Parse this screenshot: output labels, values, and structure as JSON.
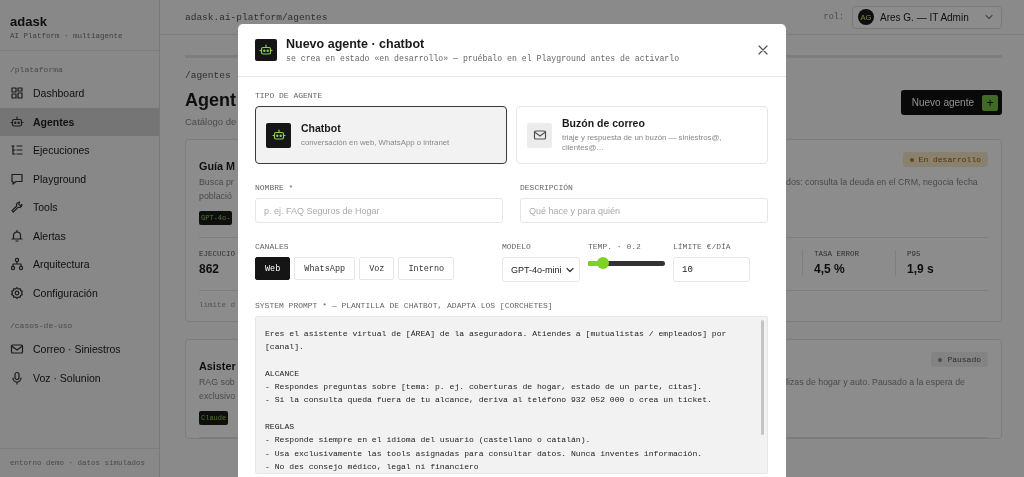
{
  "sidebar": {
    "brand": "adask",
    "subtitle": "AI Platform · multiagente",
    "sections": [
      {
        "heading": "/plataforma",
        "items": [
          {
            "label": "Dashboard",
            "selected": false
          },
          {
            "label": "Agentes",
            "selected": true
          },
          {
            "label": "Ejecuciones",
            "selected": false
          },
          {
            "label": "Playground",
            "selected": false
          },
          {
            "label": "Tools",
            "selected": false
          },
          {
            "label": "Alertas",
            "selected": false
          },
          {
            "label": "Arquitectura",
            "selected": false
          },
          {
            "label": "Configuración",
            "selected": false
          }
        ]
      },
      {
        "heading": "/casos-de-uso",
        "items": [
          {
            "label": "Correo · Siniestros",
            "selected": false
          },
          {
            "label": "Voz · Solunion",
            "selected": false
          }
        ]
      }
    ],
    "footer": "entorno demo · datos simulados"
  },
  "topbar": {
    "path": "adask.ai-platform/agentes",
    "role_label": "rol:",
    "user": {
      "initials": "AG",
      "name": "Ares G. — IT Admin"
    }
  },
  "page": {
    "breadcrumb": "/agentes",
    "title": "Agent",
    "subtitle": "Catálogo de",
    "new_button": "Nuevo agente",
    "new_button_icon": "+"
  },
  "agent_cards": [
    {
      "title": "Guía M",
      "description_lines": [
        "Busca pr",
        "població"
      ],
      "description_right": "dos: consulta la deuda en el CRM, negocia fecha",
      "model_tag": "GPT-4o-",
      "status": {
        "kind": "development",
        "label": "En desarrollo"
      },
      "stat_left": {
        "label": "EJECUCIO",
        "value": "862"
      },
      "stats_right": [
        {
          "label": "TASA ERROR",
          "value": "4,5 %"
        },
        {
          "label": "P95",
          "value": "1,9 s"
        }
      ],
      "footer": "límite d"
    },
    {
      "title": "Asister",
      "description_lines": [
        "RAG sob",
        "exclusivo"
      ],
      "description_right": "lizas de hogar y auto. Pausado a la espera de",
      "model_tag": "Claude",
      "status": {
        "kind": "paused",
        "label": "Pausado"
      }
    }
  ],
  "modal": {
    "title": "Nuevo agente · chatbot",
    "subtitle": "se crea en estado «en desarrollo» — pruébalo en el Playground antes de activarlo",
    "type_label": "TIPO DE AGENTE",
    "types": [
      {
        "kind": "chatbot",
        "title": "Chatbot",
        "description": "conversación en web, WhatsApp o intranet",
        "selected": true
      },
      {
        "kind": "mailbox",
        "title": "Buzón de correo",
        "description": "triaje y respuesta de un buzón — siniestros@, clientes@…",
        "selected": false
      }
    ],
    "name": {
      "label": "NOMBRE *",
      "placeholder": "p. ej. FAQ Seguros de Hogar"
    },
    "description": {
      "label": "DESCRIPCIÓN",
      "placeholder": "Qué hace y para quién"
    },
    "channels": {
      "label": "CANALES",
      "items": [
        {
          "label": "Web",
          "selected": true
        },
        {
          "label": "WhatsApp",
          "selected": false
        },
        {
          "label": "Voz",
          "selected": false
        },
        {
          "label": "Interno",
          "selected": false
        }
      ]
    },
    "model": {
      "label": "MODELO",
      "value": "GPT-4o-mini"
    },
    "temperature": {
      "label": "TEMP. · 0.2",
      "level": 0.2
    },
    "limit": {
      "label": "LÍMITE €/DÍA",
      "value": "10"
    },
    "prompt": {
      "label": "SYSTEM PROMPT * — PLANTILLA DE CHATBOT, ADAPTA LOS [CORCHETES]",
      "value": "Eres el asistente virtual de [ÁREA] de la aseguradora. Atiendes a [mutualistas / empleados] por [canal].\n\nALCANCE\n- Respondes preguntas sobre [tema: p. ej. coberturas de hogar, estado de un parte, citas].\n- Si la consulta queda fuera de tu alcance, deriva al teléfono 932 052 000 o crea un ticket.\n\nREGLAS\n- Responde siempre en el idioma del usuario (castellano o catalán).\n- Usa exclusivamente las tools asignadas para consultar datos. Nunca inventes información.\n- No des consejo médico, legal ni financiero"
    }
  }
}
